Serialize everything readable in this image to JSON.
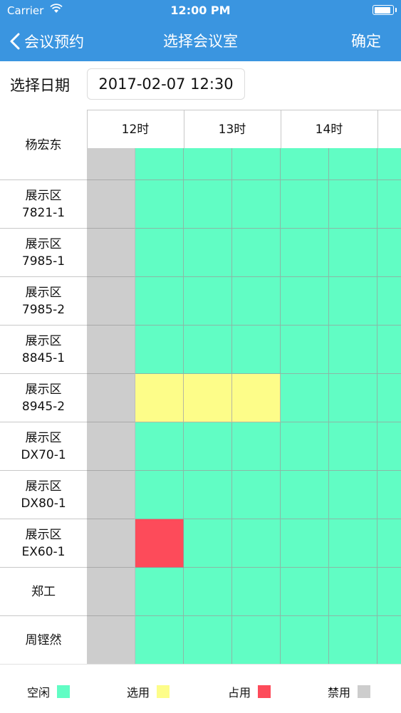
{
  "status_bar": {
    "carrier": "Carrier",
    "time": "12:00 PM"
  },
  "nav": {
    "back_label": "会议预约",
    "title": "选择会议室",
    "confirm_label": "确定"
  },
  "date": {
    "label": "选择日期",
    "value": "2017-02-07 12:30"
  },
  "grid": {
    "hours": [
      "12时",
      "13时",
      "14时"
    ],
    "rooms": [
      {
        "lines": [
          "杨宏东"
        ],
        "slots": [
          "disabled",
          "free",
          "free",
          "free",
          "free",
          "free",
          "free"
        ]
      },
      {
        "lines": [
          "展示区",
          "7821-1"
        ],
        "slots": [
          "disabled",
          "free",
          "free",
          "free",
          "free",
          "free",
          "free"
        ]
      },
      {
        "lines": [
          "展示区",
          "7985-1"
        ],
        "slots": [
          "disabled",
          "free",
          "free",
          "free",
          "free",
          "free",
          "free"
        ]
      },
      {
        "lines": [
          "展示区",
          "7985-2"
        ],
        "slots": [
          "disabled",
          "free",
          "free",
          "free",
          "free",
          "free",
          "free"
        ]
      },
      {
        "lines": [
          "展示区",
          "8845-1"
        ],
        "slots": [
          "disabled",
          "free",
          "free",
          "free",
          "free",
          "free",
          "free"
        ]
      },
      {
        "lines": [
          "展示区",
          "8945-2"
        ],
        "slots": [
          "disabled",
          "selected",
          "selected",
          "selected",
          "free",
          "free",
          "free"
        ]
      },
      {
        "lines": [
          "展示区",
          "DX70-1"
        ],
        "slots": [
          "disabled",
          "free",
          "free",
          "free",
          "free",
          "free",
          "free"
        ]
      },
      {
        "lines": [
          "展示区",
          "DX80-1"
        ],
        "slots": [
          "disabled",
          "free",
          "free",
          "free",
          "free",
          "free",
          "free"
        ]
      },
      {
        "lines": [
          "展示区",
          "EX60-1"
        ],
        "slots": [
          "disabled",
          "occupied",
          "free",
          "free",
          "free",
          "free",
          "free"
        ]
      },
      {
        "lines": [
          "郑工"
        ],
        "slots": [
          "disabled",
          "free",
          "free",
          "free",
          "free",
          "free",
          "free"
        ]
      },
      {
        "lines": [
          "周铿然"
        ],
        "slots": [
          "disabled",
          "free",
          "free",
          "free",
          "free",
          "free",
          "free"
        ]
      }
    ]
  },
  "legend": [
    {
      "label": "空闲",
      "status": "free",
      "color": "#61fdc4"
    },
    {
      "label": "选用",
      "status": "selected",
      "color": "#fdfd89"
    },
    {
      "label": "占用",
      "status": "occupied",
      "color": "#fd4b5a"
    },
    {
      "label": "禁用",
      "status": "disabled",
      "color": "#cdcdcd"
    }
  ],
  "icons": {
    "back": "chevron-left-icon",
    "wifi": "wifi-icon",
    "battery": "battery-icon"
  },
  "colors": {
    "accent": "#3a95e0"
  }
}
